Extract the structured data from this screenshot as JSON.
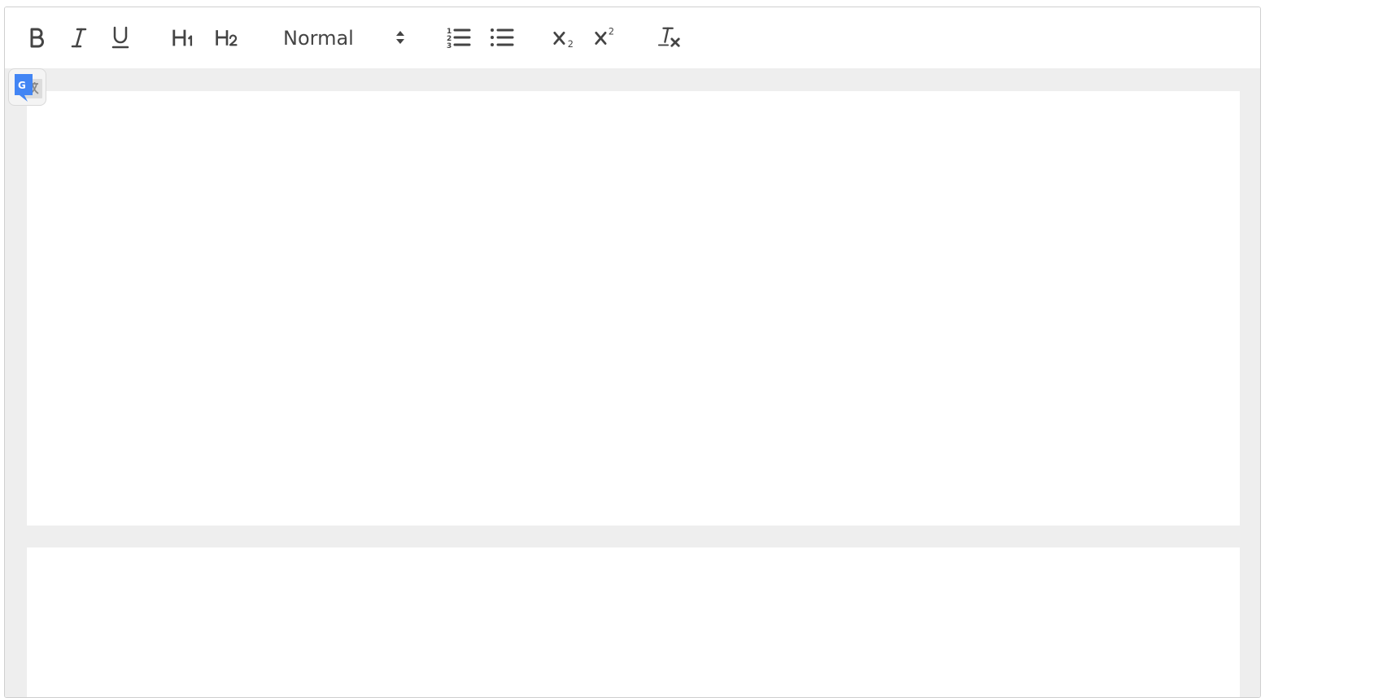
{
  "toolbar": {
    "buttons": [
      {
        "name": "bold-button",
        "icon": "bold-icon"
      },
      {
        "name": "italic-button",
        "icon": "italic-icon"
      },
      {
        "name": "underline-button",
        "icon": "underline-icon"
      },
      {
        "name": "heading-1-button",
        "icon": "heading-1-icon"
      },
      {
        "name": "heading-2-button",
        "icon": "heading-2-icon"
      },
      {
        "name": "ordered-list-button",
        "icon": "ordered-list-icon"
      },
      {
        "name": "bullet-list-button",
        "icon": "bullet-list-icon"
      },
      {
        "name": "subscript-button",
        "icon": "subscript-icon"
      },
      {
        "name": "superscript-button",
        "icon": "superscript-icon"
      },
      {
        "name": "clear-formatting-button",
        "icon": "clear-formatting-icon"
      }
    ],
    "format_select": {
      "value": "Normal",
      "icon": "updown-arrows-icon"
    }
  },
  "translate_widget": {
    "icon": "google-translate-icon"
  },
  "colors": {
    "icon": "#444444",
    "toolbar_border": "#d4d4d4",
    "workspace_bg": "#eeeeee",
    "page_bg": "#ffffff",
    "translate_blue": "#4285f4"
  }
}
